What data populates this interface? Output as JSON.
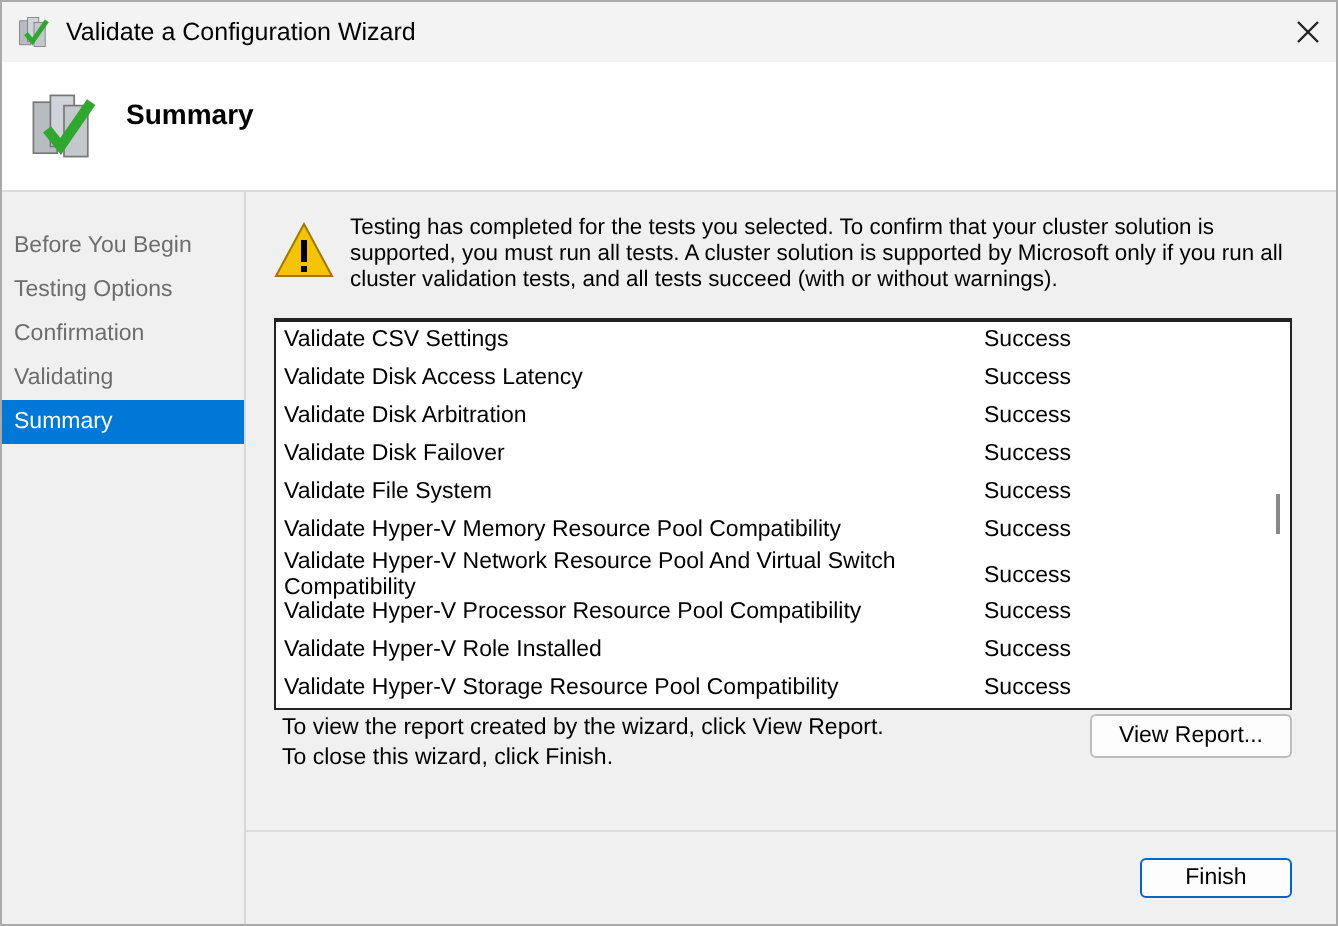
{
  "window": {
    "title": "Validate a Configuration Wizard"
  },
  "header": {
    "title": "Summary"
  },
  "sidebar": {
    "items": [
      {
        "label": "Before You Begin",
        "selected": false
      },
      {
        "label": "Testing Options",
        "selected": false
      },
      {
        "label": "Confirmation",
        "selected": false
      },
      {
        "label": "Validating",
        "selected": false
      },
      {
        "label": "Summary",
        "selected": true
      }
    ]
  },
  "message": "Testing has completed for the tests you selected. To confirm that your cluster solution is supported, you must run all tests.  A cluster solution is supported by Microsoft only if you run all cluster validation tests, and all tests succeed (with or without warnings).",
  "results": [
    {
      "test": "Validate CSV Settings",
      "result": "Success"
    },
    {
      "test": "Validate Disk Access Latency",
      "result": "Success"
    },
    {
      "test": "Validate Disk Arbitration",
      "result": "Success"
    },
    {
      "test": "Validate Disk Failover",
      "result": "Success"
    },
    {
      "test": "Validate File System",
      "result": "Success"
    },
    {
      "test": "Validate Hyper-V Memory Resource Pool Compatibility",
      "result": "Success"
    },
    {
      "test": "Validate Hyper-V Network Resource Pool And Virtual Switch Compatibility",
      "result": "Success"
    },
    {
      "test": "Validate Hyper-V Processor Resource Pool Compatibility",
      "result": "Success"
    },
    {
      "test": "Validate Hyper-V Role Installed",
      "result": "Success"
    },
    {
      "test": "Validate Hyper-V Storage Resource Pool Compatibility",
      "result": "Success"
    }
  ],
  "footer_notes": [
    "To view the report created by the wizard, click View Report.",
    "To close this wizard, click Finish."
  ],
  "buttons": {
    "view_report": "View Report...",
    "finish": "Finish"
  }
}
